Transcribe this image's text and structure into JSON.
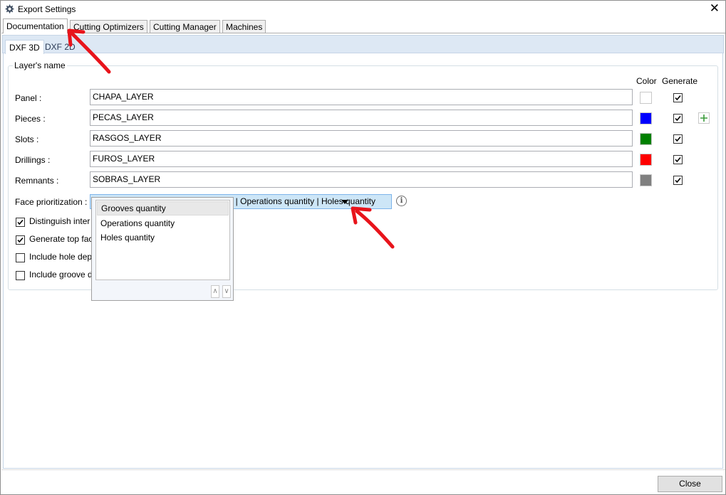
{
  "window": {
    "title": "Export Settings",
    "icon": "gear-icon",
    "close_glyph": "✕"
  },
  "tabs": [
    {
      "label": "Documentation",
      "active": true
    },
    {
      "label": "Cutting Optimizers",
      "active": false
    },
    {
      "label": "Cutting Manager",
      "active": false
    },
    {
      "label": "Machines",
      "active": false
    }
  ],
  "subtabs": [
    {
      "label": "DXF 3D",
      "active": true
    },
    {
      "label": "DXF 2D",
      "active": false
    }
  ],
  "layers": {
    "group_title": "Layer's name",
    "color_header": "Color",
    "generate_header": "Generate",
    "rows": [
      {
        "label": "Panel :",
        "value": "CHAPA_LAYER",
        "color": "#ffffff",
        "generate": true
      },
      {
        "label": "Pieces :",
        "value": "PECAS_LAYER",
        "color": "#0000ff",
        "generate": true
      },
      {
        "label": "Slots :",
        "value": "RASGOS_LAYER",
        "color": "#008000",
        "generate": true
      },
      {
        "label": "Drillings :",
        "value": "FUROS_LAYER",
        "color": "#ff0000",
        "generate": true
      },
      {
        "label": "Remnants :",
        "value": "SOBRAS_LAYER",
        "color": "#808080",
        "generate": true
      }
    ],
    "add_button_glyph": "+"
  },
  "face_prioritization": {
    "label": "Face prioritization :",
    "value": "Grooves quantity | Operations quantity | Holes quantity",
    "options": [
      "Grooves quantity",
      "Operations quantity",
      "Holes quantity"
    ],
    "selected_option": "Grooves quantity",
    "up_glyph": "∧",
    "down_glyph": "∨",
    "info_glyph": "i"
  },
  "options": [
    {
      "label": "Distinguish inter",
      "checked": true
    },
    {
      "label": "Generate top fac",
      "checked": true
    },
    {
      "label": "Include hole dep",
      "checked": false
    },
    {
      "label": "Include groove d",
      "checked": false
    }
  ],
  "footer": {
    "close_label": "Close"
  },
  "annotation_color": "#e8141b"
}
